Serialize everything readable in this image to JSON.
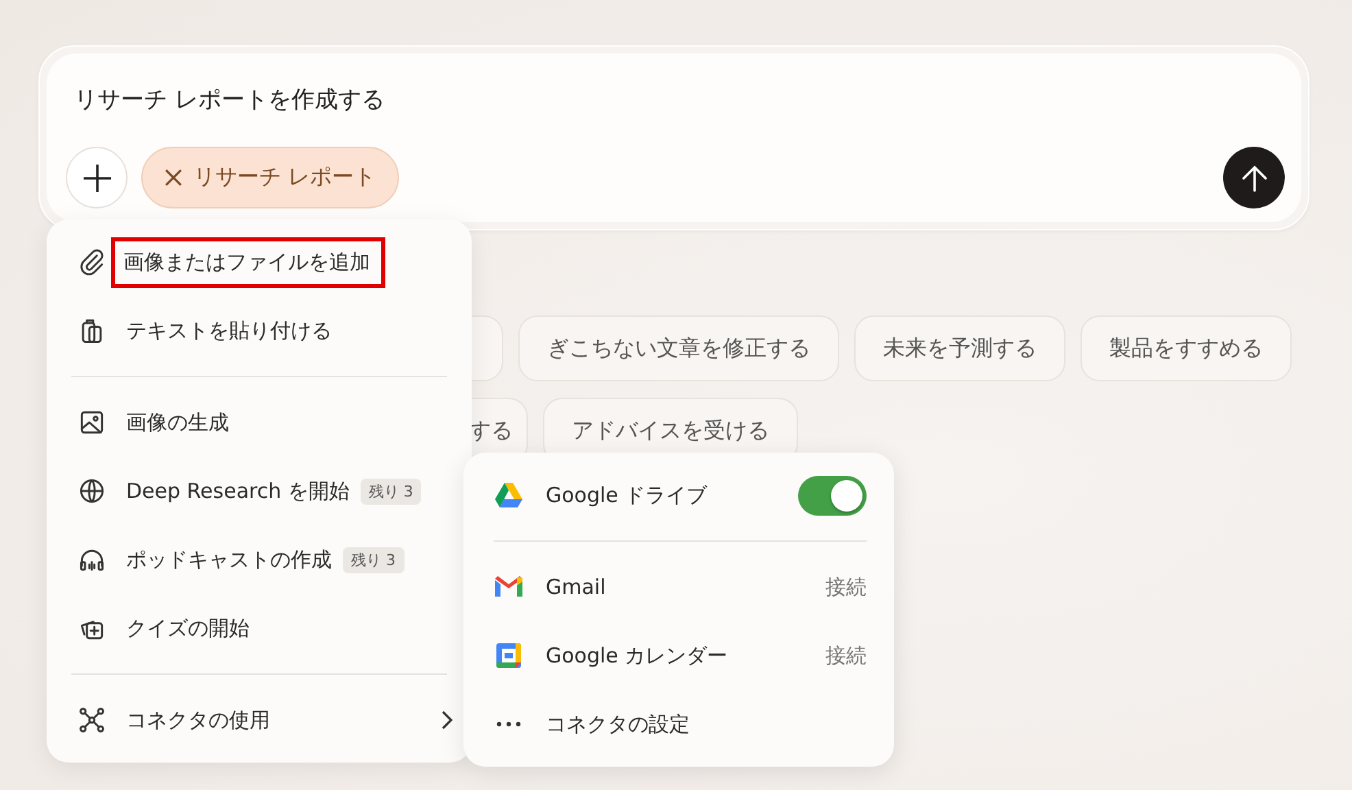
{
  "composer": {
    "text": "リサーチ レポートを作成する",
    "mode_chip": {
      "label": "リサーチ レポート"
    }
  },
  "suggestions": [
    {
      "hidden_chip": true,
      "chips": [
        {
          "label": "ぎこちない文章を修正する"
        },
        {
          "label": "未来を予測する"
        },
        {
          "label": "製品をすすめる"
        }
      ]
    },
    {
      "hidden_chip": false,
      "chips": [
        {
          "label": "する"
        },
        {
          "label": "アドバイスを受ける"
        }
      ]
    }
  ],
  "menu": {
    "sections": [
      [
        {
          "kind": "attach",
          "label": "画像またはファイルを追加",
          "highlighted": true
        },
        {
          "kind": "paste",
          "label": "テキストを貼り付ける",
          "highlighted": false
        }
      ],
      [
        {
          "kind": "image",
          "label": "画像の生成",
          "highlighted": false
        },
        {
          "kind": "research",
          "label": "Deep Research を開始",
          "badge": "残り 3",
          "highlighted": false
        },
        {
          "kind": "podcast",
          "label": "ポッドキャストの作成",
          "badge": "残り 3",
          "highlighted": false
        },
        {
          "kind": "quiz",
          "label": "クイズの開始",
          "highlighted": false
        }
      ],
      [
        {
          "kind": "connectors",
          "label": "コネクタの使用",
          "highlighted": false,
          "submenu": true
        }
      ]
    ]
  },
  "connectors": {
    "sections": [
      [
        {
          "kind": "drive",
          "label": "Google ドライブ",
          "on": true
        }
      ],
      [
        {
          "kind": "gmail",
          "label": "Gmail",
          "status": "接続"
        },
        {
          "kind": "calendar",
          "label": "Google カレンダー",
          "status": "接続"
        },
        {
          "kind": "settings",
          "label": "コネクタの設定"
        }
      ]
    ]
  }
}
